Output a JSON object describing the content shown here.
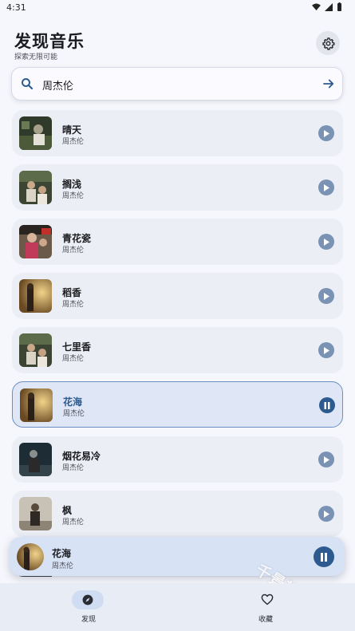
{
  "status_bar": {
    "time": "4:31"
  },
  "header": {
    "title": "发现音乐",
    "subtitle": "探索无限可能"
  },
  "search": {
    "value": "周杰伦"
  },
  "songs": [
    {
      "title": "晴天",
      "artist": "周杰伦",
      "state": "play"
    },
    {
      "title": "搁浅",
      "artist": "周杰伦",
      "state": "play"
    },
    {
      "title": "青花瓷",
      "artist": "周杰伦",
      "state": "play"
    },
    {
      "title": "稻香",
      "artist": "周杰伦",
      "state": "play"
    },
    {
      "title": "七里香",
      "artist": "周杰伦",
      "state": "play"
    },
    {
      "title": "花海",
      "artist": "周杰伦",
      "state": "pause",
      "active": true
    },
    {
      "title": "烟花易冷",
      "artist": "周杰伦",
      "state": "play"
    },
    {
      "title": "枫",
      "artist": "周杰伦",
      "state": "play"
    }
  ],
  "now_playing": {
    "title": "花海",
    "artist": "周杰伦"
  },
  "watermark": "千景软件站",
  "bottom_nav": [
    {
      "label": "发现",
      "icon": "compass-icon",
      "selected": true
    },
    {
      "label": "收藏",
      "icon": "heart-icon",
      "selected": false
    }
  ],
  "colors": {
    "accent": "#2d5a8f",
    "play_button": "#7a92b4",
    "background": "#f6f7fc"
  }
}
